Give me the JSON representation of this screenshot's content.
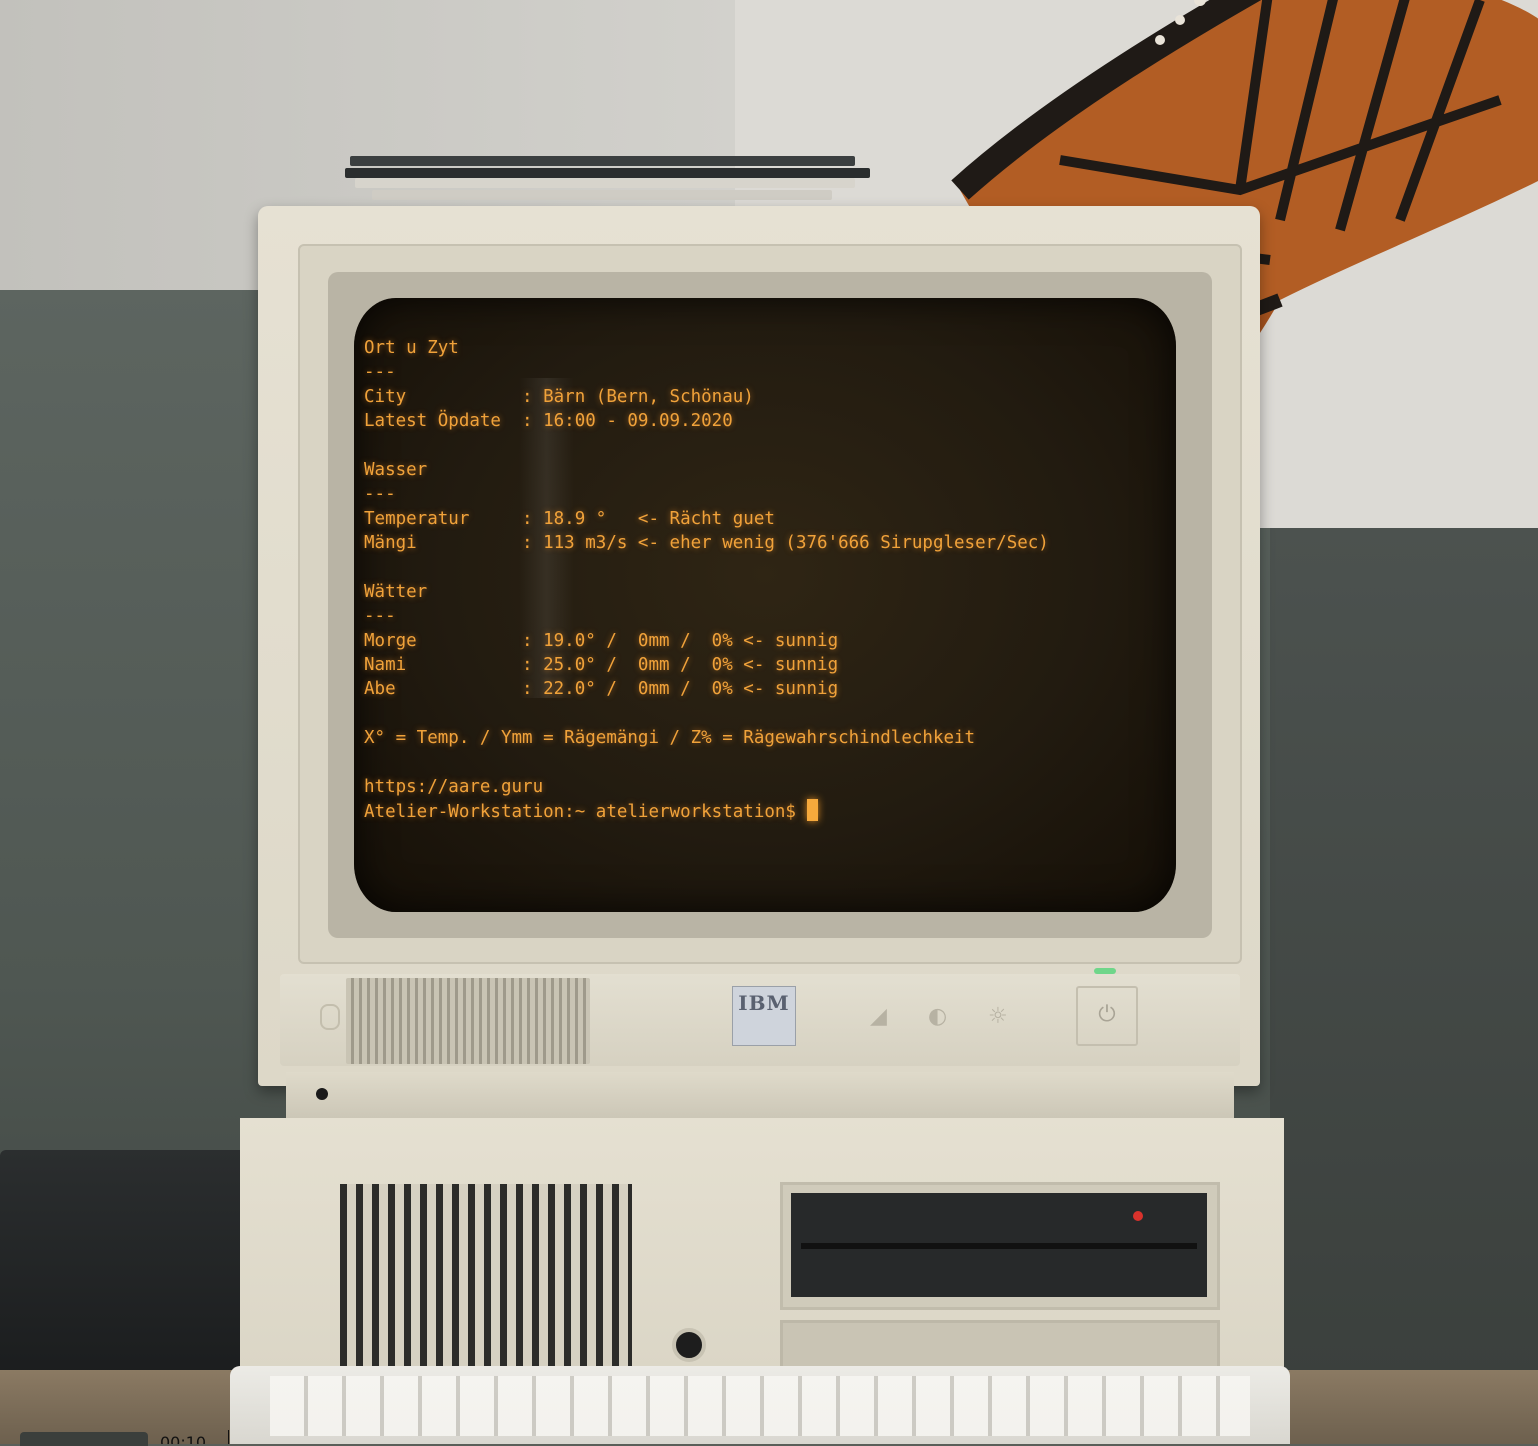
{
  "terminal": {
    "lines": [
      "Ort u Zyt",
      "---",
      "City           : Bärn (Bern, Schönau)",
      "Latest Öpdate  : 16:00 - 09.09.2020",
      "",
      "Wasser",
      "---",
      "Temperatur     : 18.9 °   <- Rächt guet",
      "Mängi          : 113 m3/s <- eher wenig (376'666 Sirupgleser/Sec)",
      "",
      "Wätter",
      "---",
      "Morge          : 19.0° /  0mm /  0% <- sunnig",
      "Nami           : 25.0° /  0mm /  0% <- sunnig",
      "Abe            : 22.0° /  0mm /  0% <- sunnig",
      "",
      "X° = Temp. / Ymm = Rägemängi / Z% = Rägewahrschindlechkeit",
      "",
      "https://aare.guru"
    ],
    "prompt": "Atelier-Workstation:~ atelierworkstation$ "
  },
  "monitor": {
    "brand": "IBM"
  },
  "video": {
    "timestamp": "00:10"
  },
  "colors": {
    "phosphor": "#f0a23a",
    "screen_bg": "#221b10",
    "case": "#e3dfd1"
  }
}
